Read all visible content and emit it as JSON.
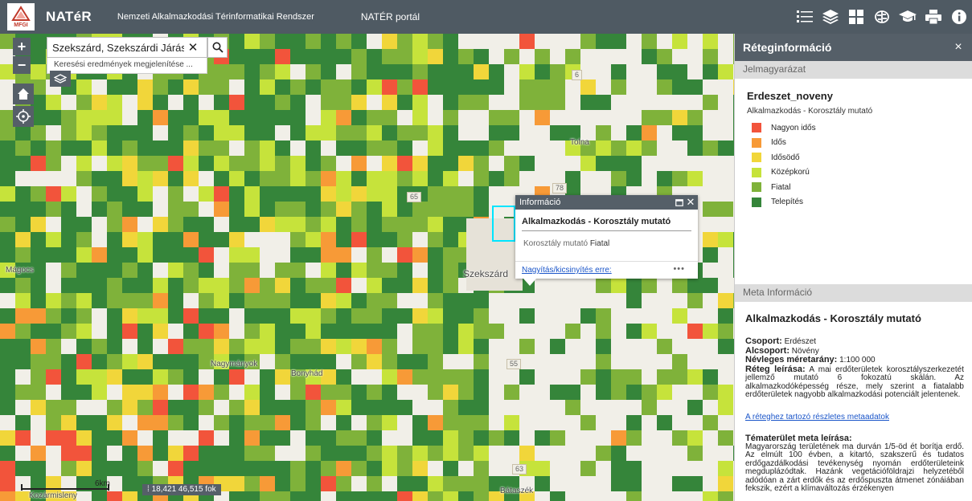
{
  "header": {
    "title": "NATéR",
    "subtitle": "Nemzeti Alkalmazkodási Térinformatikai Rendszer",
    "portal_link": "NATÉR portál",
    "logo_text": "MFGI"
  },
  "toolbar": {
    "icons": [
      "list-icon",
      "layers-icon",
      "grid-icon",
      "brain-icon",
      "graduation-cap-icon",
      "print-icon",
      "info-icon"
    ],
    "bg_color": "#4f5a63"
  },
  "map": {
    "zoom_in": "+",
    "zoom_out": "−",
    "search": {
      "value": "Szekszárd, Szekszárdi Járás, Tolna",
      "clear": "✕",
      "hint": "Keresési eredmények megjelenítése ..."
    },
    "place_names": {
      "magocs": "Mágocs",
      "szekszard": "Szekszárd",
      "bonyhad": "Bonyhád",
      "nagymanyok": "Nagymányok",
      "tolna": "Tolna",
      "bataszek": "Bátaszék",
      "kozarmisleny": "Kozármisleny"
    },
    "road_labels": {
      "r6": "6",
      "r65": "65",
      "r78": "78",
      "r55": "55",
      "r63": "63"
    },
    "scale_label": "6km",
    "coordinates": "18,421 46,515 fok"
  },
  "popup": {
    "title": "Információ",
    "heading": "Alkalmazkodás - Korosztály mutató",
    "attribute_label": "Korosztály mutató",
    "attribute_value": "Fiatal",
    "zoom_link": "Nagyítás/kicsinyítés erre:",
    "more": "•••"
  },
  "panel": {
    "title": "Réteginformáció",
    "close": "×",
    "legend_section": "Jelmagyarázat",
    "layer_name": "Erdeszet_noveny",
    "legend_caption": "Alkalmazkodás - Korosztály mutató",
    "legend": [
      {
        "label": "Nagyon idős",
        "color": "#f2543b"
      },
      {
        "label": "Idős",
        "color": "#f79a37"
      },
      {
        "label": "Idősödő",
        "color": "#f1d63a"
      },
      {
        "label": "Középkorú",
        "color": "#c6e33b"
      },
      {
        "label": "Fiatal",
        "color": "#7fb23a"
      },
      {
        "label": "Telepítés",
        "color": "#35853a"
      }
    ],
    "meta_section": "Meta Információ",
    "meta": {
      "title": "Alkalmazkodás - Korosztály mutató",
      "group_key": "Csoport:",
      "group_value": "Erdészet",
      "subgroup_key": "Alcsoport:",
      "subgroup_value": "Növény",
      "scale_key": "Névleges méretarány:",
      "scale_value": "1:100 000",
      "desc_key": "Réteg leírása:",
      "desc_value": "A mai erdőterületek korosztályszerkezetét jellemző mutató 6 fokozatú skálán. Az alkalmazkodóképesség része, mely szerint a fiatalabb erdőterületek nagyobb alkalmazkodási potenciált jelentenek.",
      "link": "A réteghez tartozó részletes metaadatok",
      "topic_key": "Tématerület meta leírása:",
      "topic_value": "Magyarország területének ma durván 1/5-öd ét borítja erdő. Az elmúlt 100 évben, a kitartó, szakszerű és tudatos erdőgazdálkodási tevékenység nyomán erdőterületeink megduplázódtak. Hazánk vegetációföldrajzi helyzetéből adódóan a zárt erdők és az erdőspuszta átmenet zónáiában fekszik, ezért a klímaváltozás érzékenyen"
    }
  }
}
